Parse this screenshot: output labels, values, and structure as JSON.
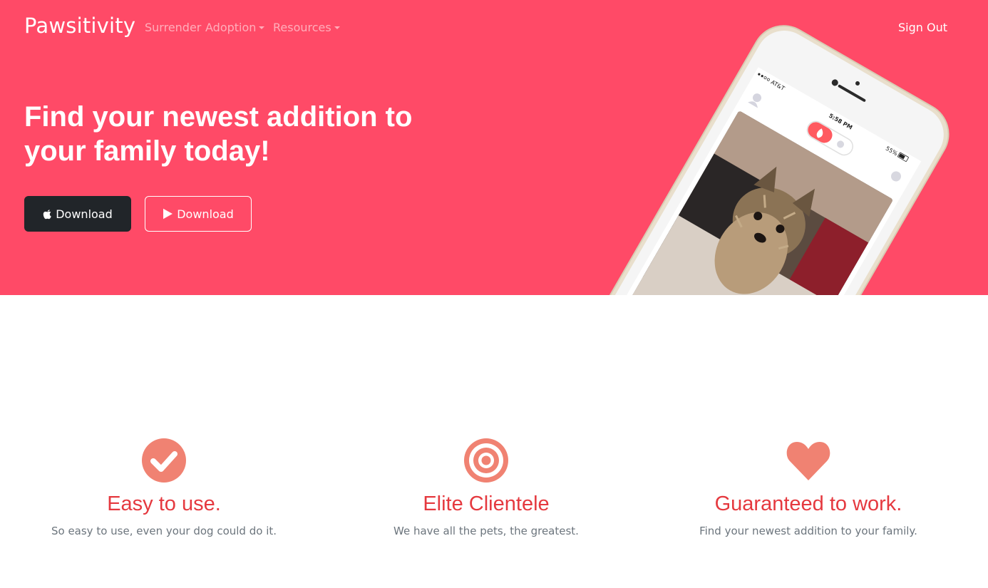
{
  "nav": {
    "brand": "Pawsitivity",
    "items": [
      {
        "label": "Surrender",
        "dropdown": false
      },
      {
        "label": "Adoption",
        "dropdown": true
      },
      {
        "label": "Resources",
        "dropdown": true
      }
    ],
    "sign_out": "Sign Out"
  },
  "hero": {
    "headline": "Find your newest addition to your family today!",
    "buttons": [
      {
        "label": "Download",
        "icon": "apple-icon",
        "style": "dark"
      },
      {
        "label": "Download",
        "icon": "google-play-icon",
        "style": "outline"
      }
    ],
    "phone": {
      "carrier": "AT&T",
      "time": "5:58 PM",
      "battery": "55%"
    }
  },
  "features": [
    {
      "icon": "check-circle-icon",
      "title": "Easy to use.",
      "text": "So easy to use, even your dog could do it."
    },
    {
      "icon": "target-icon",
      "title": "Elite Clientele",
      "text": "We have all the pets, the greatest."
    },
    {
      "icon": "heart-icon",
      "title": "Guaranteed to work.",
      "text": "Find your newest addition to your family."
    }
  ],
  "colors": {
    "hero_bg": "#ff4a67",
    "feature_title": "#e5393f",
    "feature_icon": "#f08272",
    "dark_button": "#212529"
  }
}
